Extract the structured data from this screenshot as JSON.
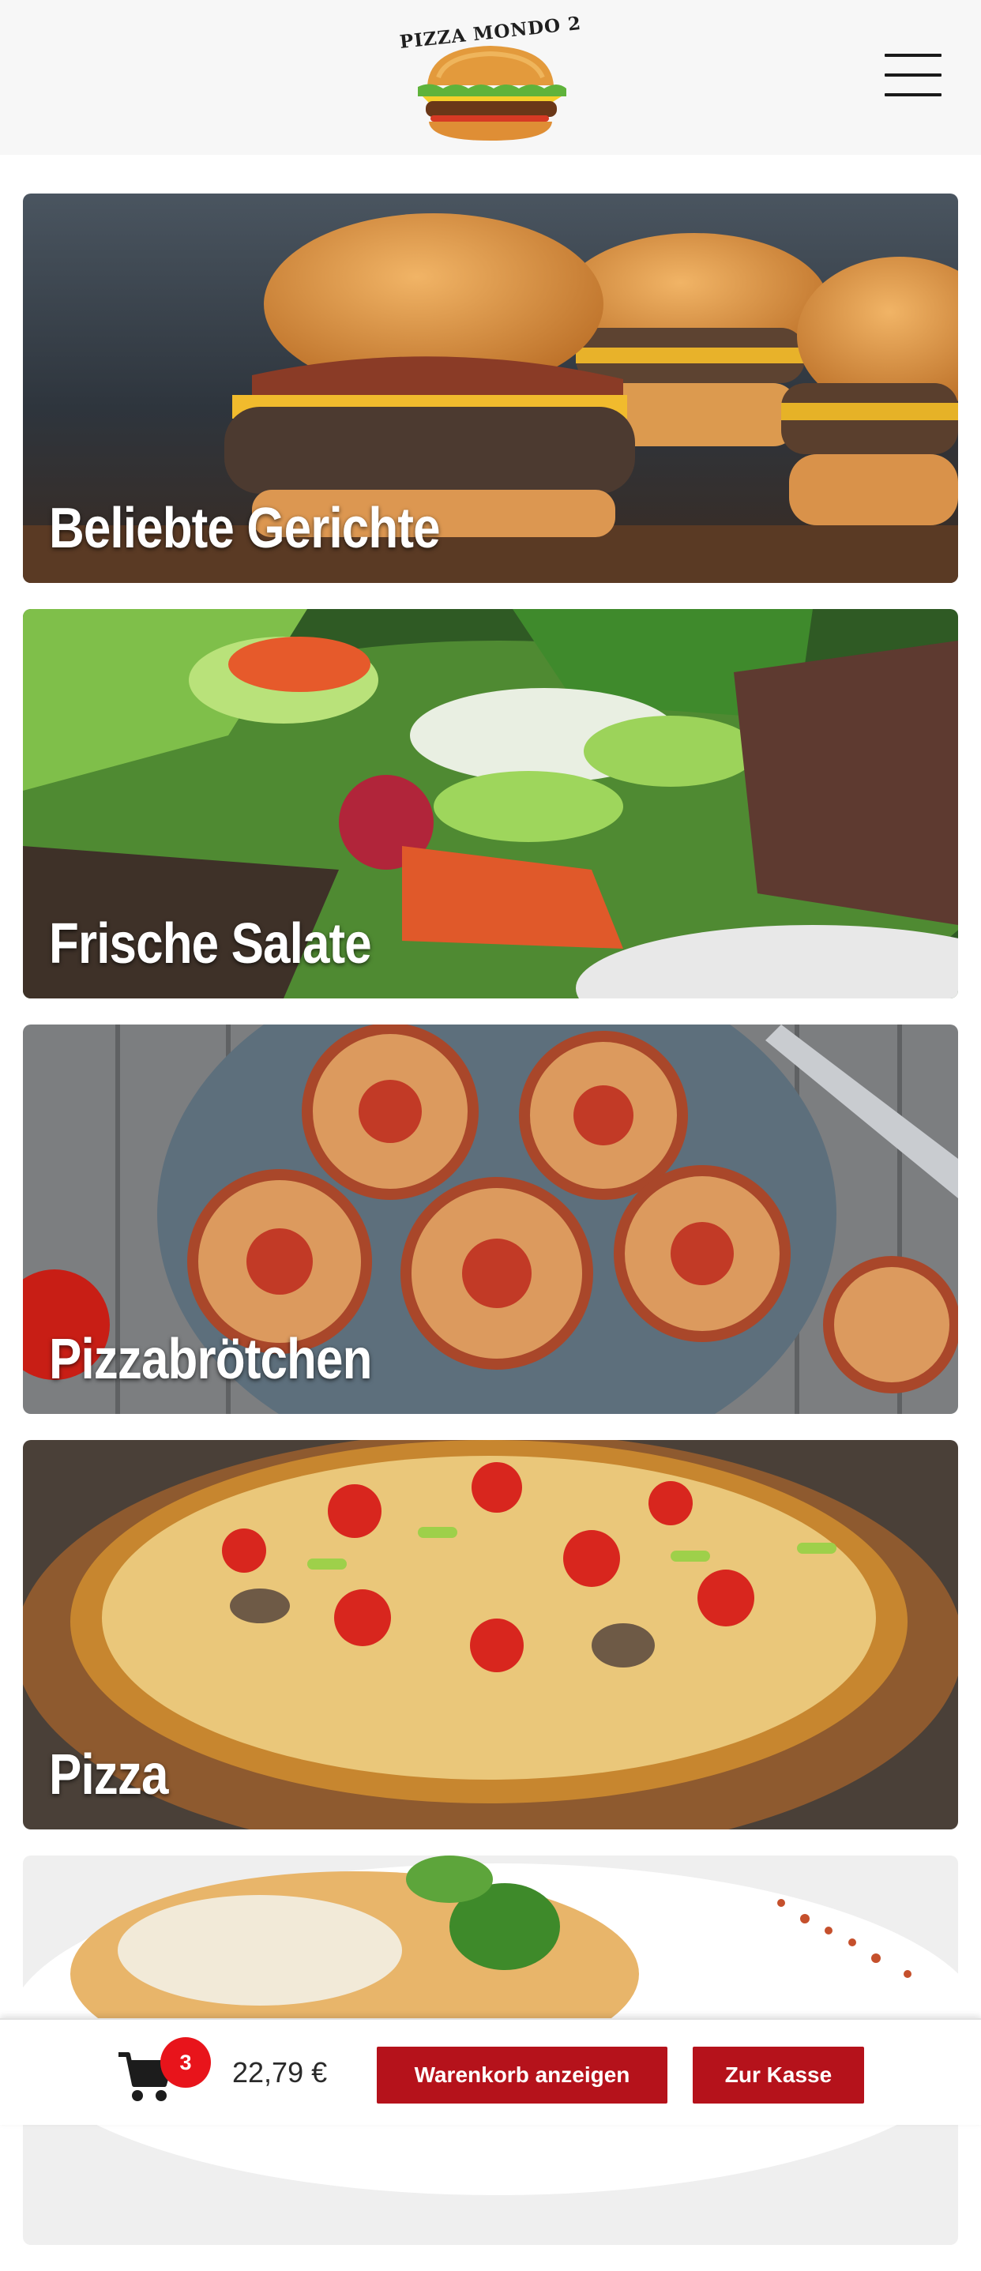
{
  "header": {
    "logo_text": "PIZZA MONDO 2"
  },
  "categories": [
    {
      "title": "Beliebte Gerichte"
    },
    {
      "title": "Frische Salate"
    },
    {
      "title": "Pizzabrötchen"
    },
    {
      "title": "Pizza"
    },
    {
      "title": ""
    }
  ],
  "cart": {
    "count": "3",
    "total": "22,79 €",
    "show_cart_label": "Warenkorb anzeigen",
    "checkout_label": "Zur Kasse"
  },
  "colors": {
    "accent": "#b5121b",
    "badge": "#e8141b",
    "header_bg": "#f7f7f7"
  },
  "icons": {
    "menu": "hamburger-menu-icon",
    "cart": "shopping-cart-icon"
  }
}
